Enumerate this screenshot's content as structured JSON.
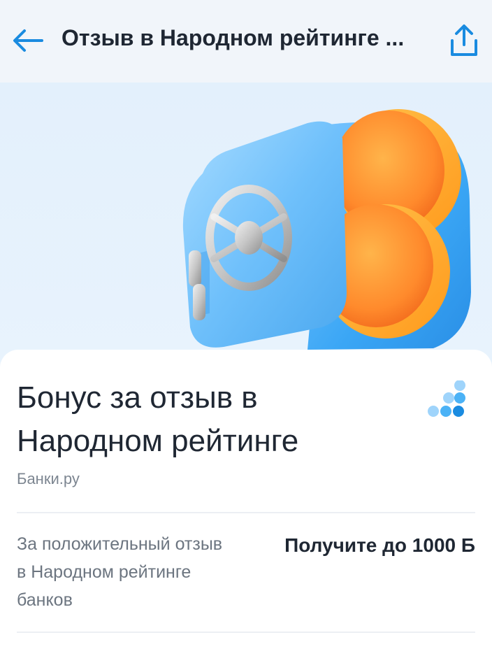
{
  "header": {
    "title": "Отзыв в Народном рейтинге ...",
    "back_icon": "arrow-left-icon",
    "share_icon": "share-icon",
    "accent_color": "#1a8be0"
  },
  "hero": {
    "illustration": "safe-with-coins",
    "background_color": "#e5f1fc"
  },
  "offer": {
    "title": "Бонус за отзыв в Народном рейтинге",
    "source": "Банки.ру",
    "logo_icon": "banki-ru-logo-icon",
    "bonus_description": "За положительный отзыв в Народном рейтинге банков",
    "bonus_value": "Получите до 1000 Б"
  }
}
